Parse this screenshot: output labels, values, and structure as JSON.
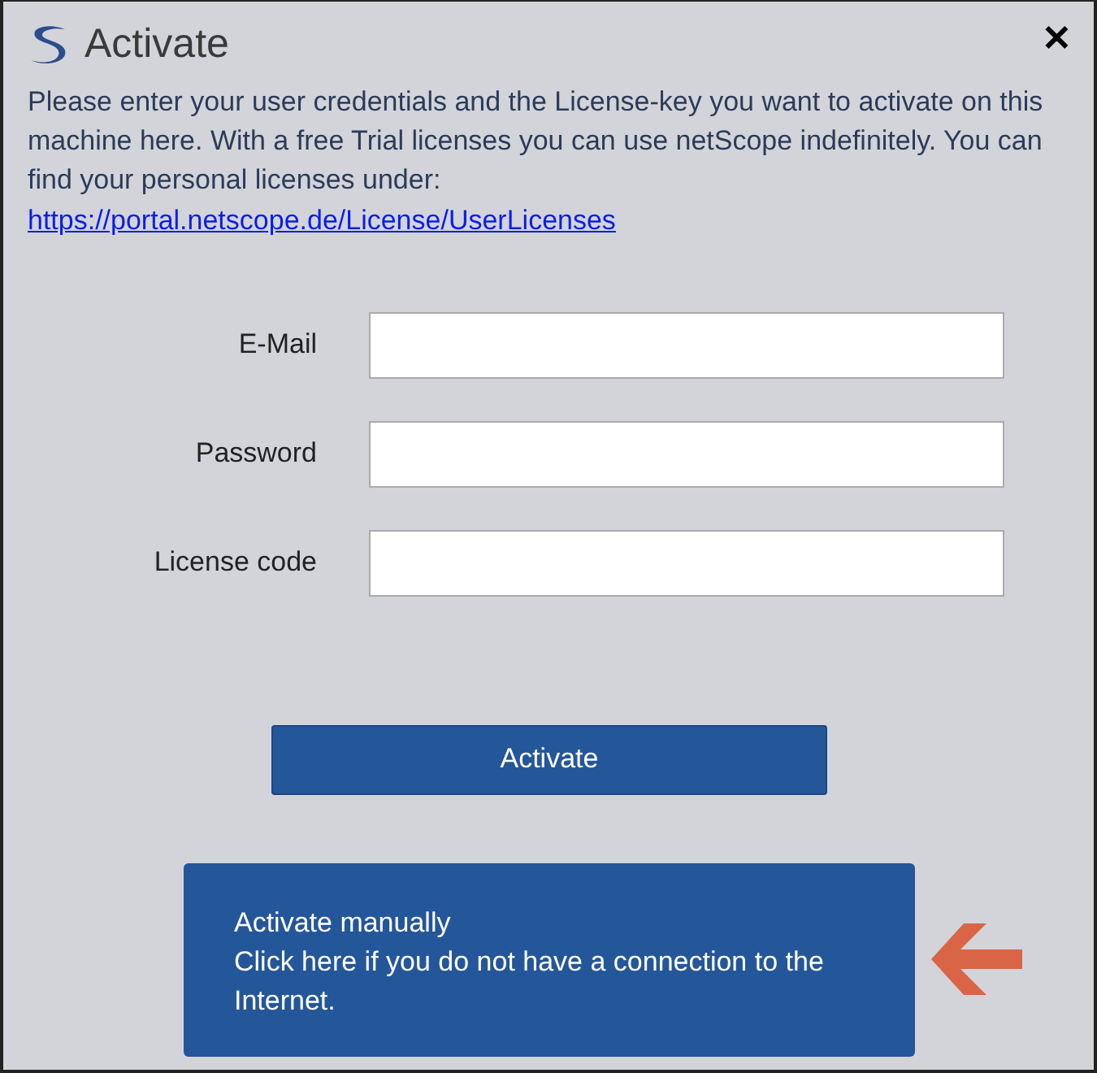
{
  "window": {
    "title": "Activate",
    "close": "✕"
  },
  "intro": {
    "text": "Please enter your user credentials and the License-key you want to activate on this machine here. With a free Trial licenses you can use netScope indefinitely. You can find your personal licenses under:",
    "link": "https://portal.netscope.de/License/UserLicenses"
  },
  "fields": [
    {
      "label": "E-Mail"
    },
    {
      "label": "Password"
    },
    {
      "label": "License code"
    }
  ],
  "activate_button": "Activate",
  "manual_button": {
    "title": "Activate manually",
    "description": "Click here if you do not have a connection to the Internet."
  }
}
